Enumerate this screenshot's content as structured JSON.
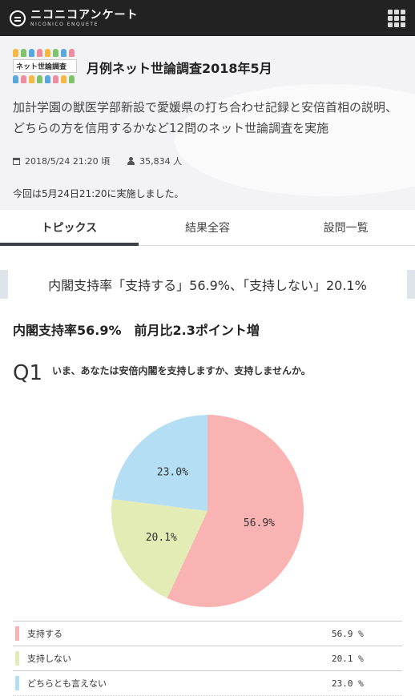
{
  "header": {
    "logo_main": "ニコニコアンケート",
    "logo_sub": "NICONICO ENQUETE"
  },
  "badge_label": "ネット世論調査",
  "survey": {
    "title": "月例ネット世論調査2018年5月",
    "description": "加計学園の獣医学部新設で愛媛県の打ち合わせ記録と安倍首相の説明、どちらの方を信用するかなど12問のネット世論調査を実施",
    "datetime": "2018/5/24 21:20 頃",
    "respondents": "35,834 人",
    "note": "今回は5月24日21:20に実施しました。"
  },
  "tabs": [
    {
      "label": "トピックス",
      "active": true
    },
    {
      "label": "結果全容",
      "active": false
    },
    {
      "label": "設問一覧",
      "active": false
    }
  ],
  "banner": "内閣支持率「支持する」56.9%、「支持しない」20.1%",
  "summary": "内閣支持率56.9%　前月比2.3ポイント増",
  "question": {
    "number": "Q1",
    "text": "いま、あなたは安倍内閣を支持しますか、支持しませんか。"
  },
  "chart_data": {
    "type": "pie",
    "categories": [
      "支持する",
      "支持しない",
      "どちらとも言えない"
    ],
    "values": [
      56.9,
      20.1,
      23.0
    ],
    "labels": [
      "56.9%",
      "20.1%",
      "23.0%"
    ],
    "legend_values": [
      "56.9 %",
      "20.1 %",
      "23.0 %"
    ],
    "colors": [
      "#f9b3b3",
      "#e3ecb5",
      "#b3def4"
    ]
  }
}
